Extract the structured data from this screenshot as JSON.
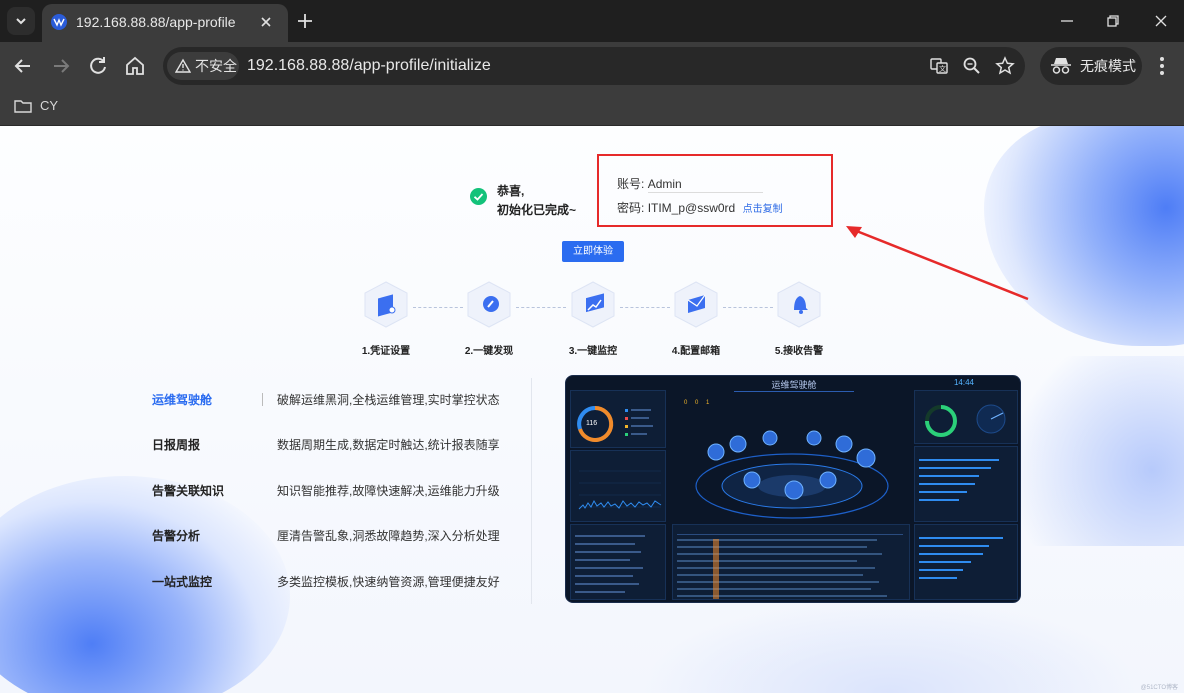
{
  "browser": {
    "tab_title": "192.168.88.88/app-profile",
    "security_label": "不安全",
    "url": "192.168.88.88/app-profile/initialize",
    "incognito_label": "无痕模式",
    "bookmark_folder": "CY"
  },
  "result": {
    "line1": "恭喜,",
    "line2": "初始化已完成~"
  },
  "credentials": {
    "account_label": "账号:",
    "account_value": "Admin",
    "password_label": "密码:",
    "password_value": "ITIM_p@ssw0rd",
    "copy_label": "点击复制"
  },
  "try_button": "立即体验",
  "steps": [
    {
      "label": "1.凭证设置",
      "icon": "credential-icon"
    },
    {
      "label": "2.一键发现",
      "icon": "discover-icon"
    },
    {
      "label": "3.一键监控",
      "icon": "monitor-icon"
    },
    {
      "label": "4.配置邮箱",
      "icon": "mail-icon"
    },
    {
      "label": "5.接收告警",
      "icon": "bell-icon"
    }
  ],
  "features": [
    {
      "name": "运维驾驶舱",
      "desc": "破解运维黑洞,全栈运维管理,实时掌控状态",
      "active": true
    },
    {
      "name": "日报周报",
      "desc": "数据周期生成,数据定时触达,统计报表随享",
      "active": false
    },
    {
      "name": "告警关联知识",
      "desc": "知识智能推荐,故障快速解决,运维能力升级",
      "active": false
    },
    {
      "name": "告警分析",
      "desc": "厘清告警乱象,洞悉故障趋势,深入分析处理",
      "active": false
    },
    {
      "name": "一站式监控",
      "desc": "多类监控模板,快速纳管资源,管理便捷友好",
      "active": false
    }
  ],
  "dashboard": {
    "title": "运维驾驶舱",
    "time": "14:44",
    "center_value": "116",
    "counter": "0 0 1"
  },
  "watermark": "@51CTO博客",
  "colors": {
    "accent": "#2b6cf0",
    "highlight_box": "#e62a2a",
    "success": "#13c27a"
  }
}
